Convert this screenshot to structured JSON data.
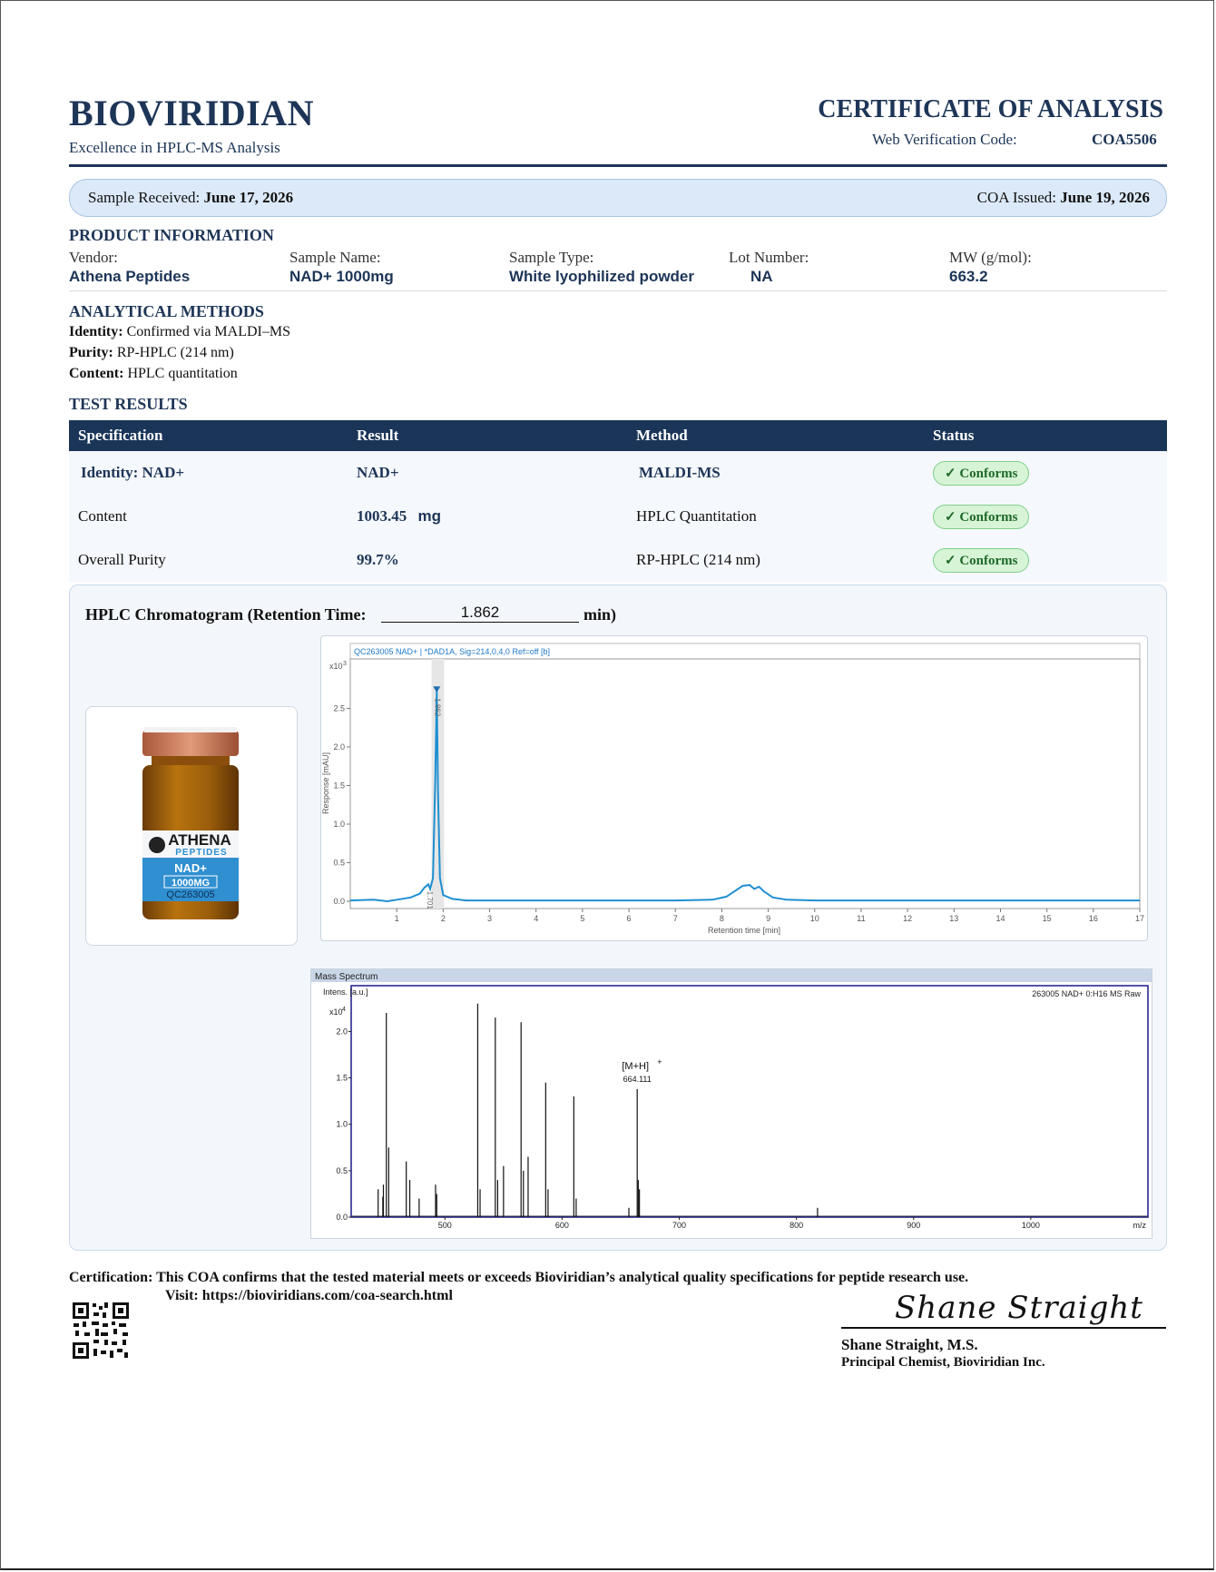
{
  "header": {
    "brand": "BIOVIRIDIAN",
    "tagline": "Excellence in HPLC-MS Analysis",
    "doc_title": "CERTIFICATE OF ANALYSIS",
    "verification_label": "Web Verification Code:",
    "verification_code": "COA5506"
  },
  "dates": {
    "received_label": "Sample Received:",
    "received_value": "June 17, 2026",
    "issued_label": "COA Issued:",
    "issued_value": "June 19, 2026"
  },
  "product": {
    "section_title": "PRODUCT INFORMATION",
    "fields": [
      {
        "label": "Vendor:",
        "value": "Athena Peptides"
      },
      {
        "label": "Sample Name:",
        "value": "NAD+ 1000mg"
      },
      {
        "label": "Sample Type:",
        "value": "White lyophilized powder"
      },
      {
        "label": "Lot Number:",
        "value": "NA"
      },
      {
        "label": "MW (g/mol):",
        "value": "663.2"
      }
    ]
  },
  "methods": {
    "section_title": "ANALYTICAL METHODS",
    "items": [
      {
        "label": "Identity:",
        "value": "Confirmed via MALDI–MS"
      },
      {
        "label": "Purity:",
        "value": "RP-HPLC (214 nm)"
      },
      {
        "label": "Content:",
        "value": "HPLC quantitation"
      }
    ]
  },
  "results": {
    "section_title": "TEST RESULTS",
    "columns": [
      "Specification",
      "Result",
      "Method",
      "Status"
    ],
    "rows": [
      {
        "spec": "Identity:  NAD+",
        "result": "NAD+",
        "unit": "",
        "method": "MALDI-MS",
        "status": "✓ Conforms"
      },
      {
        "spec": "Content",
        "result": "1003.45",
        "unit": "mg",
        "method": "HPLC Quantitation",
        "status": "✓ Conforms"
      },
      {
        "spec": "Overall Purity",
        "result": "99.7%",
        "unit": "",
        "method": "RP-HPLC (214 nm)",
        "status": "✓ Conforms"
      }
    ]
  },
  "chromatogram": {
    "title": "HPLC Chromatogram (Retention Time:",
    "retention_value": "1.862",
    "unit": "min)"
  },
  "vial": {
    "brand_line1": "ATHENA",
    "brand_line2": "PEPTIDES",
    "product": "NAD+",
    "dose": "1000MG",
    "code": "QC263005"
  },
  "chart_data": [
    {
      "type": "line",
      "header": "QC263005 NAD+ | *DAD1A, Sig=214,0,4,0 Ref=off [b]",
      "xlabel": "Retention time [min]",
      "ylabel": "Response [mAU]",
      "y_multiplier": "x10",
      "y_exponent": "3",
      "xlim": [
        0,
        17
      ],
      "ylim": [
        0,
        3.0
      ],
      "x_ticks": [
        1,
        2,
        3,
        4,
        5,
        6,
        7,
        8,
        9,
        10,
        11,
        12,
        13,
        14,
        15,
        16,
        17
      ],
      "y_ticks": [
        0.0,
        0.5,
        1.0,
        1.5,
        2.0,
        2.5
      ],
      "peak_labels": [
        {
          "x": 1.862,
          "y": 2.75,
          "text": "1.862"
        },
        {
          "x": 1.701,
          "y": 0.25,
          "text": "1.701"
        }
      ],
      "points": [
        [
          0,
          0.01
        ],
        [
          0.5,
          0.02
        ],
        [
          0.8,
          0.0
        ],
        [
          1.0,
          0.02
        ],
        [
          1.3,
          0.05
        ],
        [
          1.5,
          0.1
        ],
        [
          1.6,
          0.18
        ],
        [
          1.68,
          0.22
        ],
        [
          1.72,
          0.16
        ],
        [
          1.78,
          0.3
        ],
        [
          1.83,
          1.6
        ],
        [
          1.862,
          2.72
        ],
        [
          1.89,
          1.4
        ],
        [
          1.93,
          0.3
        ],
        [
          2.0,
          0.08
        ],
        [
          2.2,
          0.03
        ],
        [
          2.5,
          0.01
        ],
        [
          3,
          0.01
        ],
        [
          4,
          0.01
        ],
        [
          5,
          0.01
        ],
        [
          6,
          0.01
        ],
        [
          7,
          0.01
        ],
        [
          7.8,
          0.02
        ],
        [
          8.1,
          0.06
        ],
        [
          8.3,
          0.14
        ],
        [
          8.45,
          0.2
        ],
        [
          8.6,
          0.21
        ],
        [
          8.7,
          0.16
        ],
        [
          8.8,
          0.19
        ],
        [
          8.9,
          0.13
        ],
        [
          9.1,
          0.05
        ],
        [
          9.4,
          0.02
        ],
        [
          10,
          0.01
        ],
        [
          11,
          0.01
        ],
        [
          12,
          0.01
        ],
        [
          13,
          0.01
        ],
        [
          14,
          0.01
        ],
        [
          15,
          0.01
        ],
        [
          16,
          0.01
        ],
        [
          17,
          0.01
        ]
      ]
    },
    {
      "type": "bar",
      "title": "Mass Spectrum",
      "annotation": "263005 NAD+ 0:H16 MS Raw",
      "ylabel": "Intens. [a.u.]",
      "y_multiplier": "x10",
      "y_exponent": "4",
      "xlabel": "m/z",
      "xlim": [
        420,
        1100
      ],
      "ylim": [
        0,
        2.2
      ],
      "x_ticks": [
        500,
        600,
        700,
        800,
        900,
        1000
      ],
      "y_ticks": [
        0.0,
        0.5,
        1.0,
        1.5,
        2.0
      ],
      "peak_label": {
        "mz": 664.111,
        "text": "[M+H]",
        "sup": "+",
        "value": "664.111"
      },
      "peaks": [
        [
          443,
          0.3
        ],
        [
          447,
          0.22
        ],
        [
          447.5,
          0.35
        ],
        [
          450,
          2.2
        ],
        [
          452,
          0.75
        ],
        [
          467,
          0.6
        ],
        [
          470,
          0.4
        ],
        [
          478,
          0.2
        ],
        [
          492,
          0.35
        ],
        [
          493,
          0.25
        ],
        [
          528,
          2.3
        ],
        [
          530,
          0.3
        ],
        [
          543,
          2.15
        ],
        [
          545,
          0.4
        ],
        [
          550,
          0.55
        ],
        [
          565,
          2.1
        ],
        [
          567,
          0.5
        ],
        [
          571,
          0.65
        ],
        [
          586,
          1.45
        ],
        [
          588,
          0.3
        ],
        [
          610,
          1.3
        ],
        [
          612,
          0.2
        ],
        [
          657,
          0.1
        ],
        [
          664.111,
          1.38
        ],
        [
          665,
          0.4
        ],
        [
          666,
          0.3
        ],
        [
          818,
          0.1
        ]
      ]
    }
  ],
  "footer": {
    "cert_text": "Certification: This COA confirms that the tested material meets or exceeds Bioviridian’s analytical quality specifications for peptide research use.",
    "visit_text": "Visit: https://bioviridians.com/coa-search.html",
    "signature": "Shane Straight",
    "signer_name": "Shane Straight, M.S.",
    "signer_title": "Principal Chemist, Bioviridian Inc."
  }
}
